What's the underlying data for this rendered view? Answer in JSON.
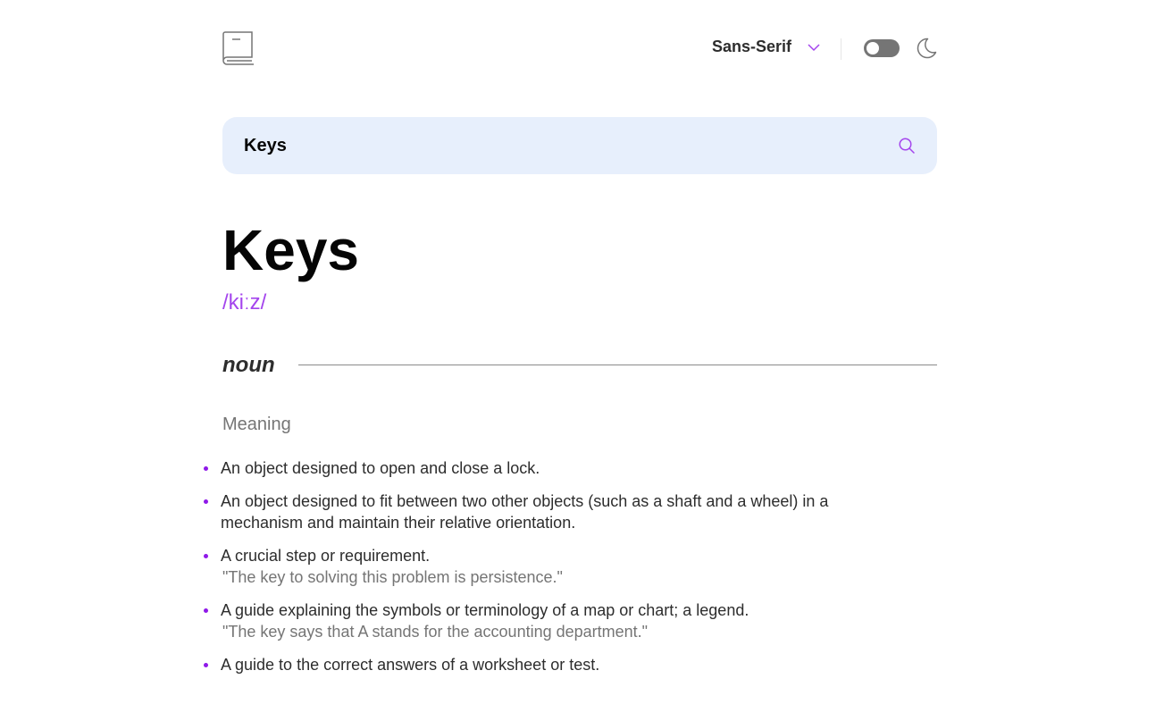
{
  "header": {
    "logo_icon": "book-icon",
    "font_selector": {
      "selected": "Sans-Serif",
      "icon": "chevron-down-icon"
    },
    "theme_toggle": {
      "on": false,
      "icon": "moon-icon"
    }
  },
  "search": {
    "value": "Keys",
    "icon": "search-icon"
  },
  "entry": {
    "word": "Keys",
    "phonetic": "/kiːz/",
    "part_of_speech": "noun",
    "meaning_heading": "Meaning",
    "definitions": [
      {
        "text": "An object designed to open and close a lock.",
        "example": ""
      },
      {
        "text": "An object designed to fit between two other objects (such as a shaft and a wheel) in a mechanism and maintain their relative orientation.",
        "example": ""
      },
      {
        "text": "A crucial step or requirement.",
        "example": "\"The key to solving this problem is persistence.\""
      },
      {
        "text": "A guide explaining the symbols or terminology of a map or chart; a legend.",
        "example": "\"The key says that A stands for the accounting department.\""
      },
      {
        "text": "A guide to the correct answers of a worksheet or test.",
        "example": ""
      }
    ]
  },
  "colors": {
    "accent": "#a445ed",
    "search_bg": "#e7effc",
    "text": "#2d2d2d",
    "muted": "#757575"
  }
}
